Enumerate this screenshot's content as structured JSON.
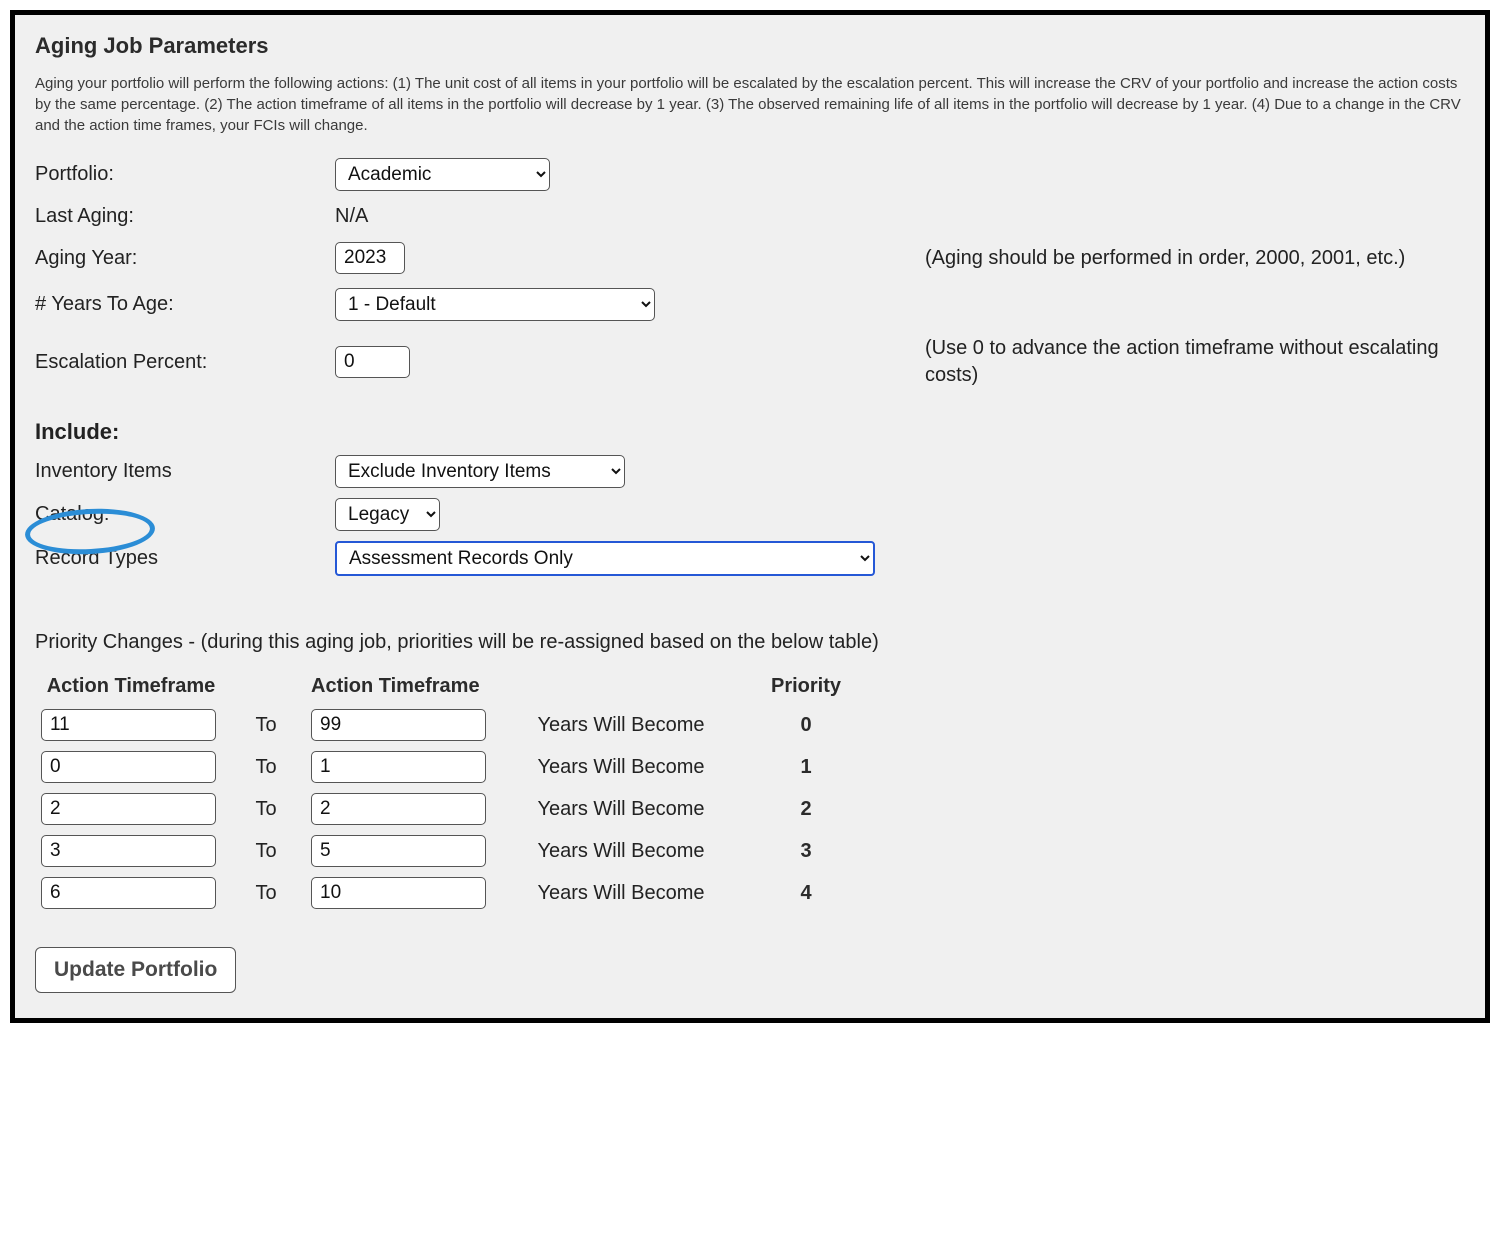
{
  "title": "Aging Job Parameters",
  "description": "Aging your portfolio will perform the following actions:  (1) The unit cost of all items in your portfolio will be escalated by the escalation percent. This will increase the CRV of your portfolio and increase the action costs by the same percentage.  (2) The action timeframe of all items in the portfolio will decrease by 1 year.  (3) The observed remaining life of all items in the portfolio will decrease by 1 year. (4) Due to a change in the CRV and the action time frames, your FCIs will change.",
  "labels": {
    "portfolio": "Portfolio:",
    "last_aging": "Last Aging:",
    "aging_year": "Aging Year:",
    "years_to_age": "# Years To Age:",
    "escalation_percent": "Escalation Percent:",
    "include": "Include:",
    "inventory_items": "Inventory Items",
    "catalog": "Catalog:",
    "record_types": "Record Types"
  },
  "values": {
    "portfolio": "Academic",
    "last_aging": "N/A",
    "aging_year": "2023",
    "years_to_age": "1 - Default",
    "escalation_percent": "0",
    "inventory_items": "Exclude Inventory Items",
    "catalog": "Legacy",
    "record_types": "Assessment Records Only"
  },
  "notes": {
    "aging_year": "(Aging should be performed in order, 2000, 2001, etc.)",
    "escalation_percent": "(Use 0 to advance the action timeframe without escalating costs)"
  },
  "priority_heading": "Priority Changes - (during this aging job, priorities will be re-assigned based on the below table)",
  "priority_columns": {
    "c1": "Action Timeframe",
    "c2": "To",
    "c3": "Action Timeframe",
    "c4": "Years Will Become",
    "c5": "Priority"
  },
  "priority_rows": [
    {
      "from": "11",
      "to": "99",
      "priority": "0"
    },
    {
      "from": "0",
      "to": "1",
      "priority": "1"
    },
    {
      "from": "2",
      "to": "2",
      "priority": "2"
    },
    {
      "from": "3",
      "to": "5",
      "priority": "3"
    },
    {
      "from": "6",
      "to": "10",
      "priority": "4"
    }
  ],
  "to_label": "To",
  "ywb_label": "Years Will Become",
  "button": {
    "update": "Update Portfolio"
  }
}
